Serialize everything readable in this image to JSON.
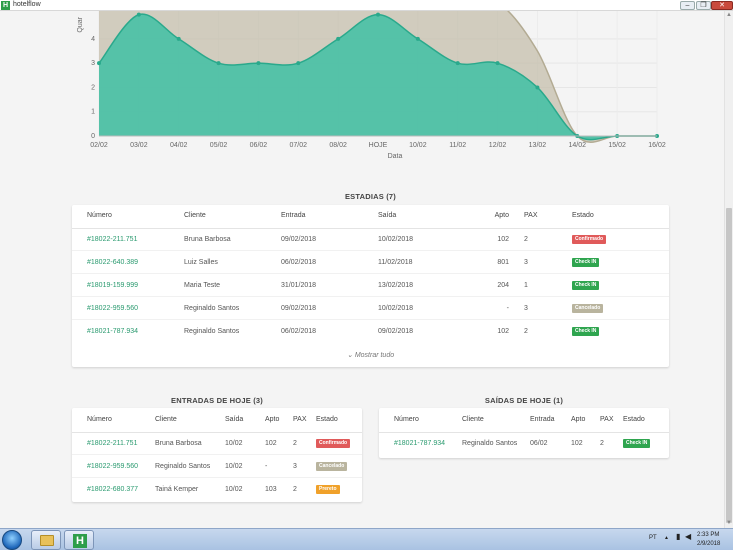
{
  "window": {
    "title": "hotelflow",
    "app_icon_letter": "H",
    "minimize": "–",
    "maximize": "❐",
    "close": "✕"
  },
  "chart_data": {
    "type": "area",
    "ylabel": "Quar",
    "xlabel": "Data",
    "categories": [
      "02/02",
      "03/02",
      "04/02",
      "05/02",
      "06/02",
      "07/02",
      "08/02",
      "HOJE",
      "10/02",
      "11/02",
      "12/02",
      "13/02",
      "14/02",
      "15/02",
      "16/02"
    ],
    "ylim": [
      0,
      5
    ],
    "yticks": [
      0,
      1,
      2,
      3,
      4
    ],
    "grid": true,
    "series": [
      {
        "values": [
          3,
          5,
          4,
          3,
          3,
          3,
          4,
          5,
          4,
          3,
          3,
          2,
          0,
          0,
          0
        ],
        "color": "#3fbfa4"
      },
      {
        "values": [
          5.5,
          5.5,
          5.5,
          5.5,
          5.5,
          5.5,
          5.5,
          5.5,
          5.5,
          5.5,
          5.5,
          3.5,
          0,
          0,
          0
        ],
        "color": "#c2bba6"
      }
    ]
  },
  "stays": {
    "title": "ESTADIAS (7)",
    "columns": [
      "Número",
      "Cliente",
      "Entrada",
      "Saída",
      "Apto",
      "PAX",
      "Estado"
    ],
    "rows": [
      {
        "numero": "#18022-211.751",
        "cliente": "Bruna Barbosa",
        "entrada": "09/02/2018",
        "saida": "10/02/2018",
        "apto": "102",
        "pax": "2",
        "estado": "Confirmado",
        "color": "#e05a5a"
      },
      {
        "numero": "#18022-640.389",
        "cliente": "Luiz Salles",
        "entrada": "06/02/2018",
        "saida": "11/02/2018",
        "apto": "801",
        "pax": "3",
        "estado": "Check IN",
        "color": "#2fa54f"
      },
      {
        "numero": "#18019-159.999",
        "cliente": "Maria Teste",
        "entrada": "31/01/2018",
        "saida": "13/02/2018",
        "apto": "204",
        "pax": "1",
        "estado": "Check IN",
        "color": "#2fa54f"
      },
      {
        "numero": "#18022-959.560",
        "cliente": "Reginaldo Santos",
        "entrada": "09/02/2018",
        "saida": "10/02/2018",
        "apto": "-",
        "pax": "3",
        "estado": "Cancelado",
        "color": "#b9b49e"
      },
      {
        "numero": "#18021-787.934",
        "cliente": "Reginaldo Santos",
        "entrada": "06/02/2018",
        "saida": "09/02/2018",
        "apto": "102",
        "pax": "2",
        "estado": "Check IN",
        "color": "#2fa54f"
      }
    ],
    "show_all": "Mostrar tudo"
  },
  "arrivals": {
    "title": "ENTRADAS DE HOJE (3)",
    "columns": [
      "Número",
      "Cliente",
      "Saída",
      "Apto",
      "PAX",
      "Estado"
    ],
    "rows": [
      {
        "numero": "#18022-211.751",
        "cliente": "Bruna Barbosa",
        "saida": "10/02",
        "apto": "102",
        "pax": "2",
        "estado": "Confirmado",
        "color": "#e05a5a"
      },
      {
        "numero": "#18022-959.560",
        "cliente": "Reginaldo Santos",
        "saida": "10/02",
        "apto": "-",
        "pax": "3",
        "estado": "Cancelado",
        "color": "#b9b49e"
      },
      {
        "numero": "#18022-680.377",
        "cliente": "Tainá Kemper",
        "saida": "10/02",
        "apto": "103",
        "pax": "2",
        "estado": "Prereto",
        "color": "#f0a12a"
      }
    ]
  },
  "departures": {
    "title": "SAÍDAS DE HOJE (1)",
    "columns": [
      "Número",
      "Cliente",
      "Entrada",
      "Apto",
      "PAX",
      "Estado"
    ],
    "rows": [
      {
        "numero": "#18021-787.934",
        "cliente": "Reginaldo Santos",
        "entrada": "06/02",
        "apto": "102",
        "pax": "2",
        "estado": "Check IN",
        "color": "#2fa54f"
      }
    ]
  },
  "taskbar": {
    "lang": "PT",
    "time": "2:33 PM",
    "date": "2/9/2018"
  }
}
